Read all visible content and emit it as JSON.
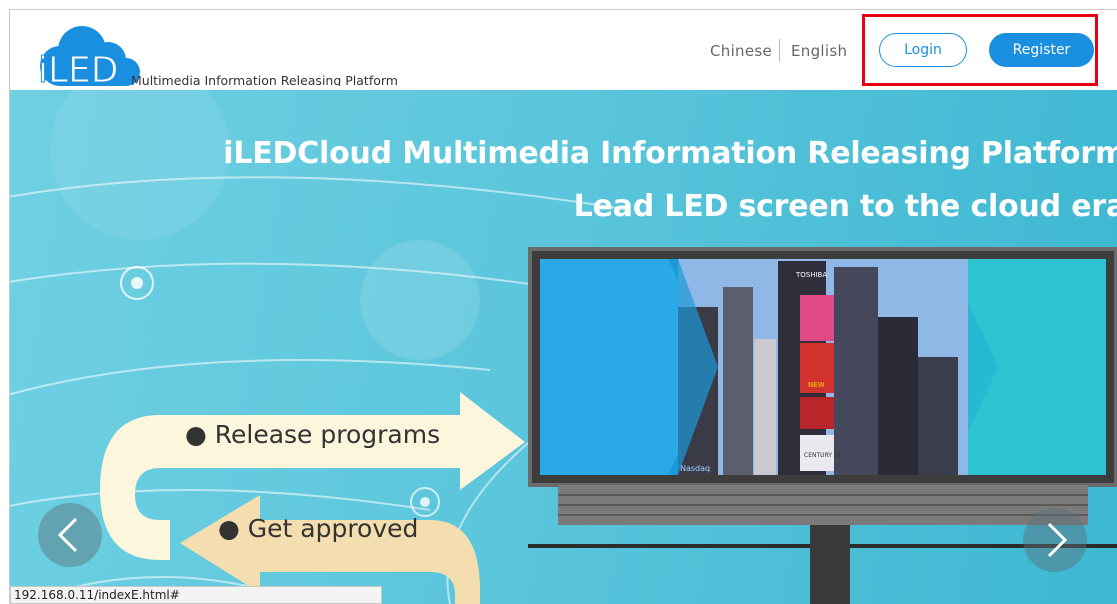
{
  "header": {
    "logo_text": "iLED",
    "tagline": "Multimedia Information Releasing Platform",
    "lang_chinese": "Chinese",
    "lang_english": "English",
    "login_label": "Login",
    "register_label": "Register"
  },
  "banner": {
    "title": "iLEDCloud Multimedia Information Releasing Platform",
    "subtitle": "Lead LED screen to the cloud era",
    "steps": [
      "● Release programs",
      "● Get approved"
    ],
    "billboard_signs": {
      "tower_brand": "TOSHIBA",
      "red_sign": "NEW",
      "bank_sign": "CENTURY 21",
      "ticker": "Nasdaq"
    }
  },
  "status_bar": {
    "url": "192.168.0.11/indexE.html#"
  },
  "colors": {
    "accent": "#1a8fe0",
    "highlight": "#e60012",
    "banner": "#4cc0d9"
  }
}
